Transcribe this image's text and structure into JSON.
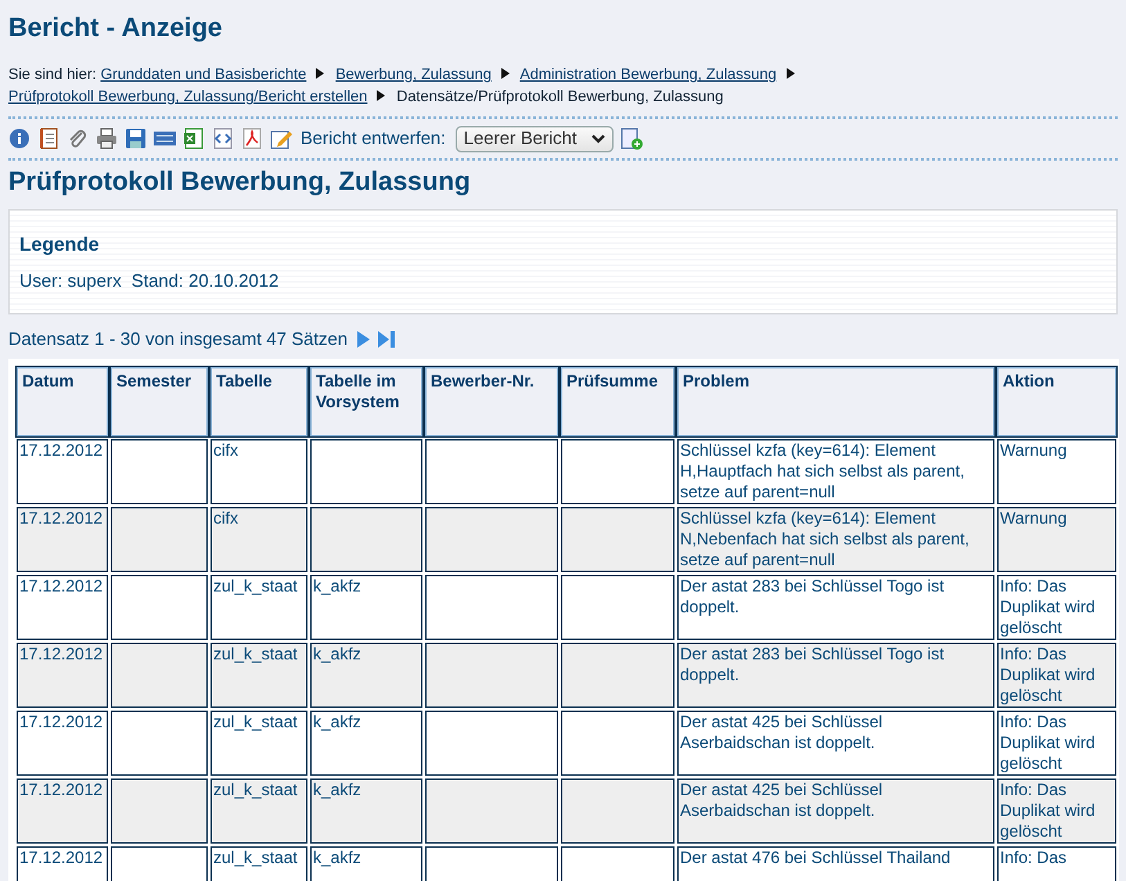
{
  "title": "Bericht - Anzeige",
  "breadcrumb": {
    "prefix": "Sie sind hier:",
    "links": [
      "Grunddaten und Basisberichte",
      "Bewerbung, Zulassung",
      "Administration Bewerbung, Zulassung",
      "Prüfprotokoll Bewerbung, Zulassung/Bericht erstellen"
    ],
    "current": "Datensätze/Prüfprotokoll Bewerbung, Zulassung"
  },
  "toolbar": {
    "label": "Bericht entwerfen:",
    "select_value": "Leerer Bericht"
  },
  "report_title": "Prüfprotokoll Bewerbung, Zulassung",
  "legend": {
    "title": "Legende",
    "text": "User: superx  Stand: 20.10.2012"
  },
  "record_info": "Datensatz 1 - 30 von insgesamt 47 Sätzen",
  "table": {
    "columns": [
      "Datum",
      "Semester",
      "Tabelle",
      "Tabelle im Vorsystem",
      "Bewerber-Nr.",
      "Prüfsumme",
      "Problem",
      "Aktion"
    ],
    "rows": [
      [
        "17.12.2012",
        "",
        "cifx",
        "",
        "",
        "",
        "Schlüssel kzfa (key=614): Element H,Hauptfach hat sich selbst als parent, setze auf parent=null",
        "Warnung"
      ],
      [
        "17.12.2012",
        "",
        "cifx",
        "",
        "",
        "",
        "Schlüssel kzfa (key=614): Element N,Nebenfach hat sich selbst als parent, setze auf parent=null",
        "Warnung"
      ],
      [
        "17.12.2012",
        "",
        "zul_k_staat",
        "k_akfz",
        "",
        "",
        "Der astat 283 bei Schlüssel Togo ist doppelt.",
        "Info: Das Duplikat wird gelöscht"
      ],
      [
        "17.12.2012",
        "",
        "zul_k_staat",
        "k_akfz",
        "",
        "",
        "Der astat 283 bei Schlüssel Togo ist doppelt.",
        "Info: Das Duplikat wird gelöscht"
      ],
      [
        "17.12.2012",
        "",
        "zul_k_staat",
        "k_akfz",
        "",
        "",
        "Der astat 425 bei Schlüssel Aserbaidschan ist doppelt.",
        "Info: Das Duplikat wird gelöscht"
      ],
      [
        "17.12.2012",
        "",
        "zul_k_staat",
        "k_akfz",
        "",
        "",
        "Der astat 425 bei Schlüssel Aserbaidschan ist doppelt.",
        "Info: Das Duplikat wird gelöscht"
      ],
      [
        "17.12.2012",
        "",
        "zul_k_staat",
        "k_akfz",
        "",
        "",
        "Der astat 476 bei Schlüssel Thailand",
        "Info: Das"
      ]
    ]
  }
}
